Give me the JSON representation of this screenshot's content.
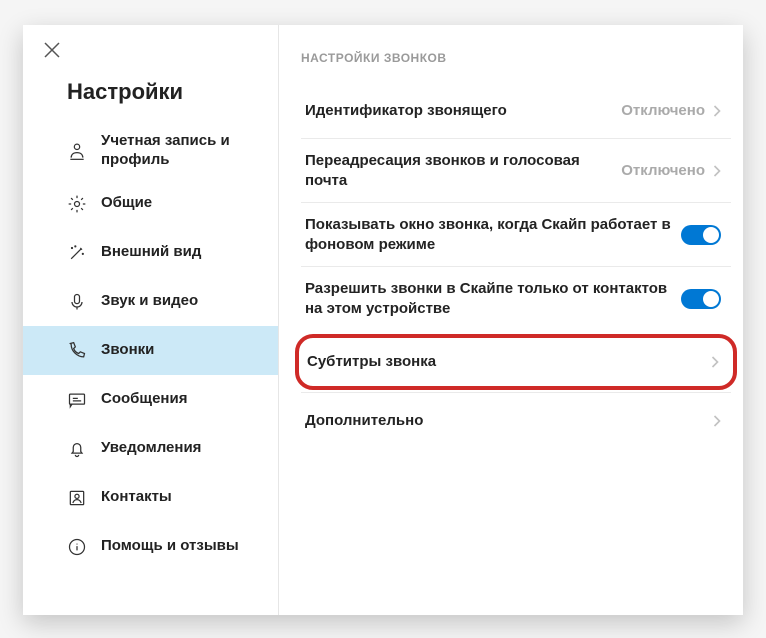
{
  "sidebar": {
    "title": "Настройки",
    "items": [
      {
        "label": "Учетная запись и профиль"
      },
      {
        "label": "Общие"
      },
      {
        "label": "Внешний вид"
      },
      {
        "label": "Звук и видео"
      },
      {
        "label": "Звонки"
      },
      {
        "label": "Сообщения"
      },
      {
        "label": "Уведомления"
      },
      {
        "label": "Контакты"
      },
      {
        "label": "Помощь и отзывы"
      }
    ]
  },
  "content": {
    "section_header": "НАСТРОЙКИ ЗВОНКОВ",
    "settings": [
      {
        "label": "Идентификатор звонящего",
        "status": "Отключено"
      },
      {
        "label": "Переадресация звонков и голосовая почта",
        "status": "Отключено"
      },
      {
        "label": "Показывать окно звонка, когда Скайп работает в фоновом режиме"
      },
      {
        "label": "Разрешить звонки в Скайпе только от контактов на этом устройстве"
      },
      {
        "label": "Субтитры звонка"
      },
      {
        "label": "Дополнительно"
      }
    ]
  }
}
